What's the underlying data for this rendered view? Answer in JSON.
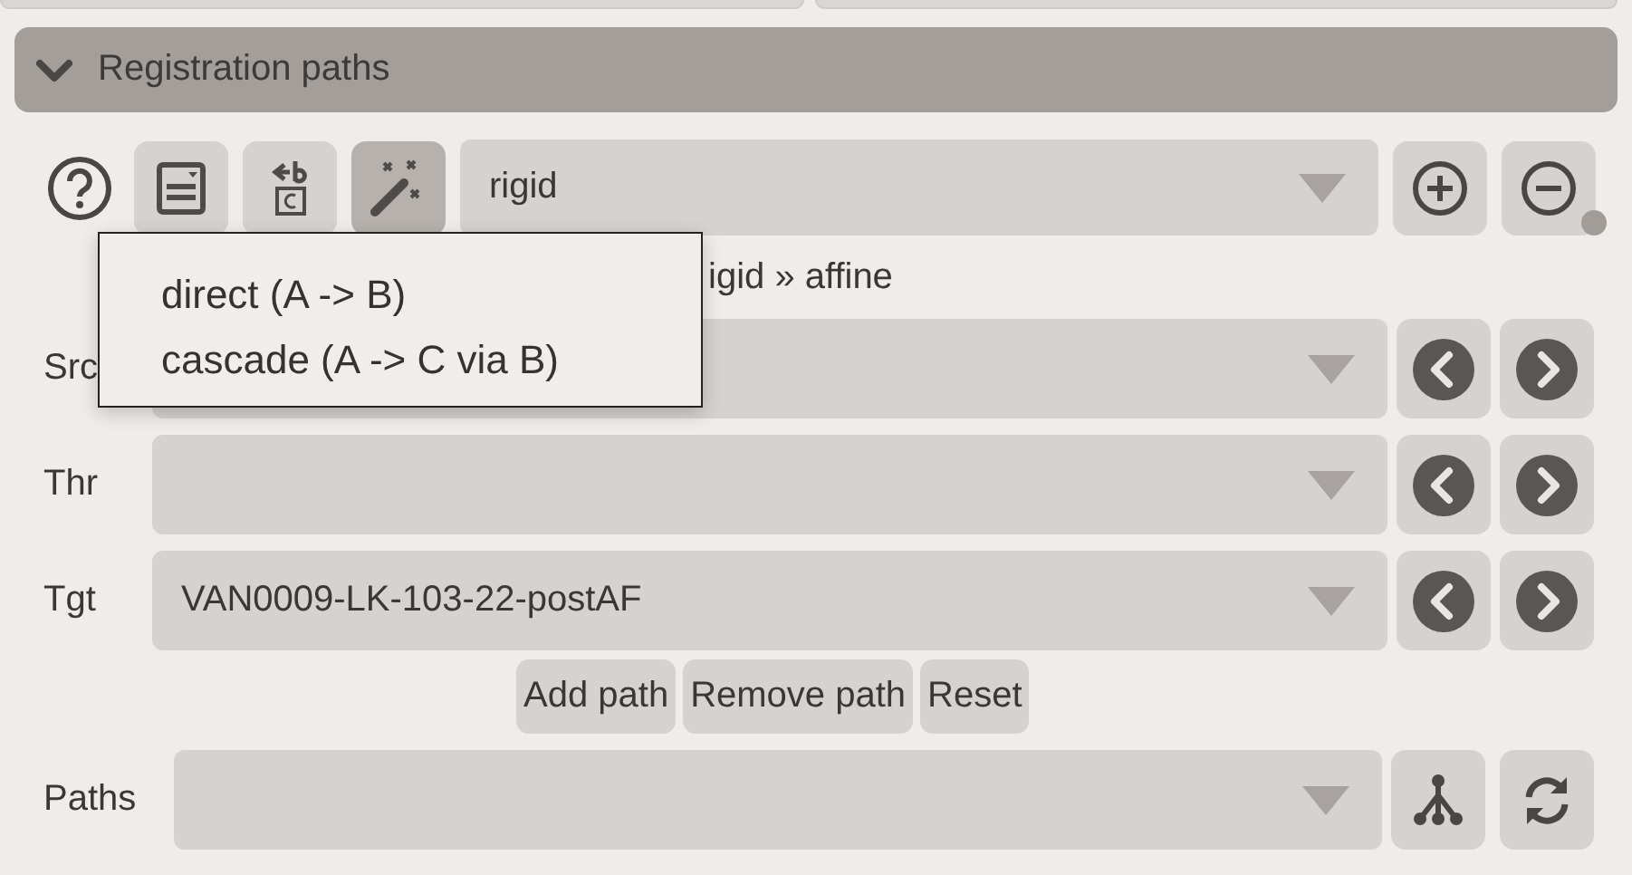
{
  "section": {
    "title": "Registration paths",
    "expanded": true
  },
  "toolbar": {
    "tools": [
      {
        "kind": "help",
        "selected": false
      },
      {
        "kind": "list",
        "selected": false
      },
      {
        "kind": "rename",
        "selected": false
      },
      {
        "kind": "wand",
        "selected": true
      }
    ],
    "method": {
      "value": "rigid"
    }
  },
  "summary": "igid » affine",
  "popup": {
    "items": [
      {
        "label": "direct (A -> B)"
      },
      {
        "label": "cascade (A -> C via B)"
      }
    ]
  },
  "fields": [
    {
      "label": "Src"
    },
    {
      "label": "Thr"
    },
    {
      "label": "Tgt",
      "value": "VAN0009-LK-103-22-postAF"
    }
  ],
  "actions": [
    "Add path",
    "Remove path",
    "Reset"
  ],
  "paths": {
    "label": "Paths"
  }
}
